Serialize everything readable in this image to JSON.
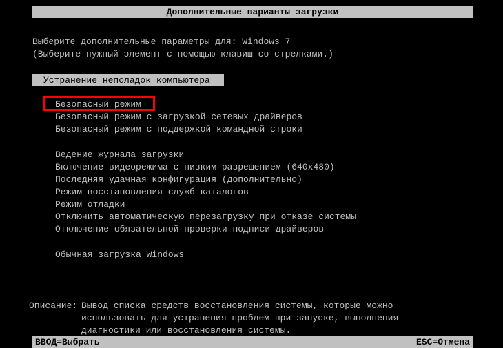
{
  "title": "Дополнительные варианты загрузки",
  "prompt": {
    "line1": "Выберите дополнительные параметры для: Windows 7",
    "line2": "(Выберите нужный элемент с помощью клавиш со стрелками.)"
  },
  "repair_option": "Устранение неполадок компьютера",
  "menu": {
    "safe_mode": "Безопасный режим",
    "safe_mode_net": "Безопасный режим с загрузкой сетевых драйверов",
    "safe_mode_cmd": "Безопасный режим с поддержкой командной строки",
    "boot_logging": "Ведение журнала загрузки",
    "low_res": "Включение видеорежима с низким разрешением (640x480)",
    "last_known": "Последняя удачная конфигурация (дополнительно)",
    "dsrm": "Режим восстановления служб каталогов",
    "debug": "Режим отладки",
    "disable_auto_restart": "Отключить автоматическую перезагрузку при отказе системы",
    "disable_sig": "Отключение обязательной проверки подписи драйверов",
    "normal": "Обычная загрузка Windows"
  },
  "description": {
    "label": "Описание:",
    "line1": "Вывод списка средств восстановления системы, которые можно",
    "line2": "использовать для устранения проблем при запуске, выполнения",
    "line3": "диагностики или восстановления системы."
  },
  "footer": {
    "select": "ВВОД=Выбрать",
    "cancel": "ESC=Отмена"
  }
}
